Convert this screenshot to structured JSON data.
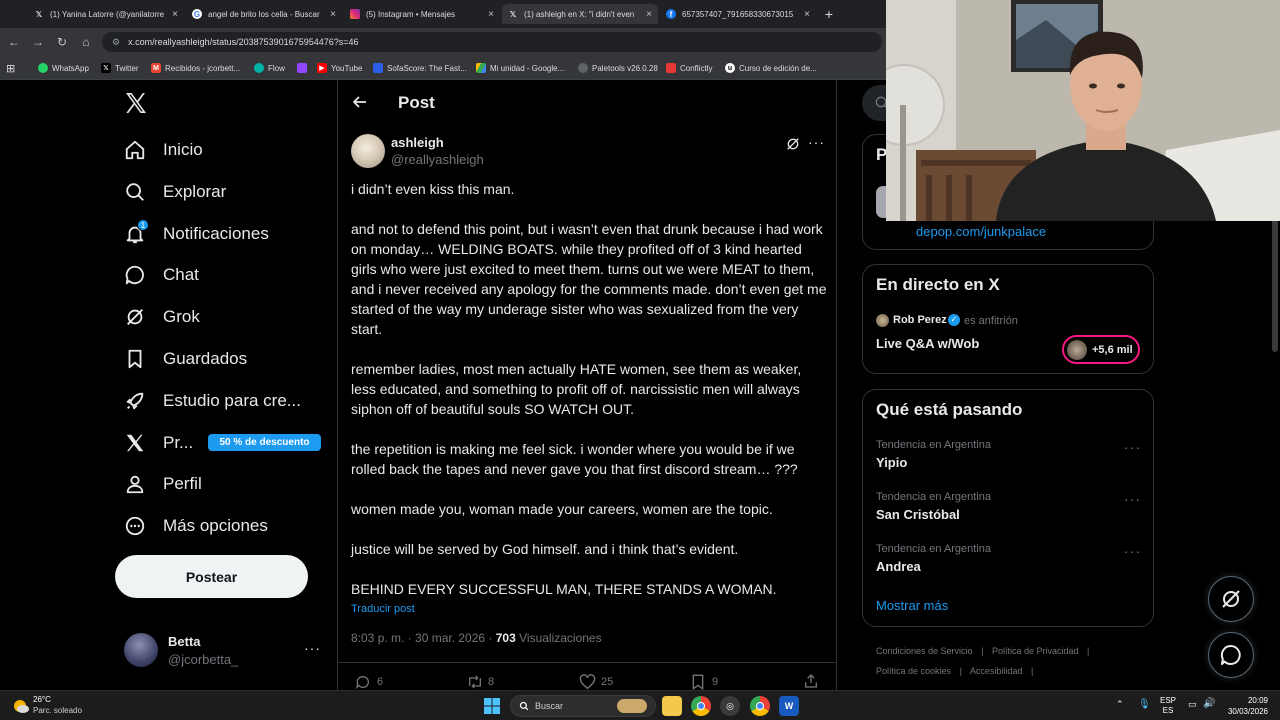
{
  "browser": {
    "tabs": [
      {
        "title": "(1) Yanina Latorre (@yanilatorre",
        "favicon": "x-icon",
        "active": false
      },
      {
        "title": "angel de brito los cella - Buscar",
        "favicon": "google-icon",
        "active": false
      },
      {
        "title": "(5) Instagram • Mensajes",
        "favicon": "instagram-icon",
        "active": false
      },
      {
        "title": "(1) ashleigh en X: \"i didn't even",
        "favicon": "x-icon",
        "active": true
      },
      {
        "title": "657357407_791658330673015",
        "favicon": "facebook-icon",
        "active": false
      }
    ],
    "url": "x.com/reallyashleigh/status/2038753901675954476?s=46",
    "bookmarks": [
      {
        "label": "WhatsApp",
        "icon": "whatsapp-icon",
        "color": "#25d366"
      },
      {
        "label": "Twitter",
        "icon": "x-icon",
        "color": "#000000"
      },
      {
        "label": "Recibidos - jcorbett...",
        "icon": "gmail-icon",
        "color": "#ea4335"
      },
      {
        "label": "Flow",
        "icon": "flow-icon",
        "color": "#00b3a6"
      },
      {
        "label": "",
        "icon": "twitch-icon",
        "color": "#9146ff"
      },
      {
        "label": "YouTube",
        "icon": "youtube-icon",
        "color": "#ff0000"
      },
      {
        "label": "SofaScore: The Fast...",
        "icon": "sofascore-icon",
        "color": "#2c5fe8"
      },
      {
        "label": "Mi unidad - Google...",
        "icon": "drive-icon",
        "color": "#fbbc04"
      },
      {
        "label": "Paletools v26.0.28",
        "icon": "paletools-icon",
        "color": "#9aa0a6"
      },
      {
        "label": "Conflictly",
        "icon": "conflictly-icon",
        "color": "#e53935"
      },
      {
        "label": "Curso de edición de...",
        "icon": "course-icon",
        "color": "#ffffff"
      }
    ]
  },
  "sidebar": {
    "items": [
      {
        "label": "Inicio",
        "icon": "home-icon"
      },
      {
        "label": "Explorar",
        "icon": "search-icon"
      },
      {
        "label": "Notificaciones",
        "icon": "bell-icon",
        "badge": "1"
      },
      {
        "label": "Chat",
        "icon": "chat-icon"
      },
      {
        "label": "Grok",
        "icon": "grok-icon"
      },
      {
        "label": "Guardados",
        "icon": "bookmark-icon"
      },
      {
        "label": "Estudio para cre...",
        "icon": "rocket-icon"
      },
      {
        "label": "Pr...",
        "icon": "x-premium-icon"
      },
      {
        "label": "Perfil",
        "icon": "person-icon"
      },
      {
        "label": "Más opciones",
        "icon": "more-circle-icon"
      }
    ],
    "premium_badge": "50 % de descuento",
    "post_button": "Postear",
    "account": {
      "name": "Betta",
      "handle": "@jcorbetta_"
    }
  },
  "post": {
    "header": "Post",
    "author_name": "ashleigh",
    "author_handle": "@reallyashleigh",
    "paragraphs": [
      "i didn’t even kiss this man.",
      "and not to defend this point, but i wasn’t even that drunk because i had work on monday… WELDING BOATS. while they profited off of 3 kind hearted girls who were just excited to meet them. turns out we were MEAT to them, and i never received any apology for the comments made. don’t even get me started of the way my underage sister who was sexualized from the very start.",
      "remember ladies, most men actually HATE women, see them as weaker, less educated, and something to profit off of. narcissistic men will always siphon off of beautiful souls SO WATCH OUT.",
      "the repetition is making me feel sick. i wonder where you would be if we rolled back the tapes and never gave you that first discord stream… ???",
      "women made you, woman made your careers, women are the topic.",
      "justice will be served by God himself. and i think that’s evident.",
      "BEHIND EVERY SUCCESSFUL MAN, THERE STANDS A WOMAN."
    ],
    "translate": "Traducir post",
    "time": "8:03 p. m. · 30 mar. 2026 · ",
    "views_count": "703",
    "views_label": " Visualizaciones",
    "stats": {
      "replies": "6",
      "reposts": "8",
      "likes": "25",
      "bookmarks": "9"
    }
  },
  "right": {
    "partial_header": "P",
    "link": "depop.com/junkpalace",
    "live": {
      "title": "En directo en X",
      "host": "Rob Perez",
      "host_role": "es anfitrión",
      "space_title": "Live Q&A w/Wob",
      "listeners": "+5,6 mil"
    },
    "trends": {
      "title": "Qué está pasando",
      "items": [
        {
          "meta": "Tendencia en Argentina",
          "name": "Yipio"
        },
        {
          "meta": "Tendencia en Argentina",
          "name": "San Cristóbal"
        },
        {
          "meta": "Tendencia en Argentina",
          "name": "Andrea"
        }
      ],
      "show_more": "Mostrar más"
    },
    "footer": [
      "Condiciones de Servicio",
      "Política de Privacidad",
      "Política de cookies",
      "Accesibilidad"
    ]
  },
  "taskbar": {
    "weather_temp": "26°C",
    "weather_desc": "Parc. soleado",
    "search_placeholder": "Buscar",
    "lang_top": "ESP",
    "lang_bottom": "ES",
    "time": "20:09",
    "date": "30/03/2026"
  },
  "colors": {
    "accent": "#1d9bf0",
    "background": "#000000",
    "live_accent": "#f91880"
  }
}
